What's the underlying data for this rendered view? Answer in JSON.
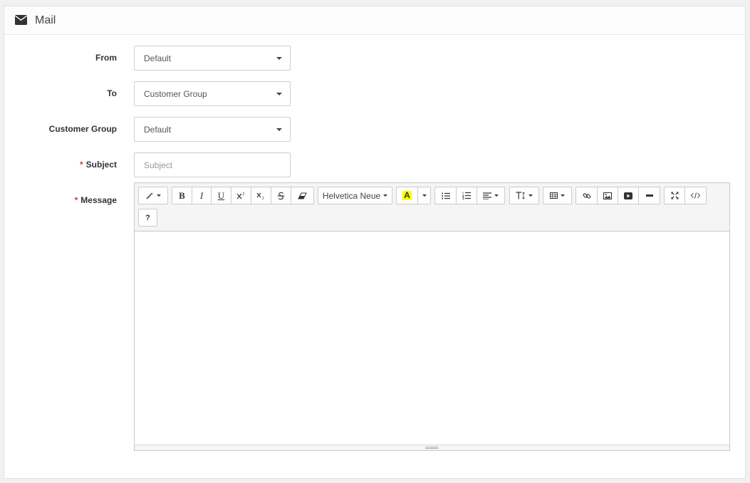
{
  "panel": {
    "title": "Mail",
    "icon": "envelope-icon"
  },
  "form": {
    "from": {
      "label": "From",
      "value": "Default"
    },
    "to": {
      "label": "To",
      "value": "Customer Group"
    },
    "customer_group": {
      "label": "Customer Group",
      "value": "Default"
    },
    "subject": {
      "label": "Subject",
      "required_mark": "*",
      "placeholder": "Subject"
    },
    "message": {
      "label": "Message",
      "required_mark": "*"
    }
  },
  "toolbar": {
    "font_name": "Helvetica Neue",
    "bold": "B",
    "italic": "I",
    "underline": "U",
    "color_sample": "A",
    "help": "?"
  },
  "colors": {
    "required": "#e3342f",
    "highlight": "#ffff00"
  }
}
